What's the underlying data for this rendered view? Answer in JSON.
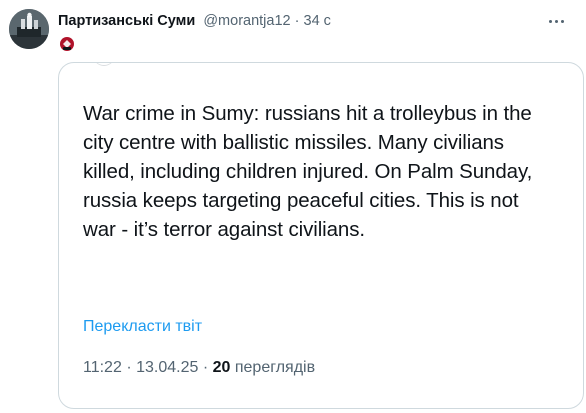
{
  "author": {
    "name": "Партизанські Суми",
    "handle": "@morantja12",
    "separator": "·",
    "time": "34 с"
  },
  "icons": {
    "avatar": "statue-avatar",
    "badge": "red-emblem-icon",
    "menu": "more-dots-icon"
  },
  "colors": {
    "link": "#1d9bf0",
    "muted": "#536471",
    "text": "#0f1419",
    "border": "#cfd9de"
  },
  "quote": {
    "text": "War crime in Sumy: russians hit a trolleybus in the city centre with ballistic missiles. Many civilians killed, including children injured. On Palm Sunday, russia keeps targeting peaceful cities. This is not war - it’s terror against civilians.",
    "translate_label": "Перекласти твіт",
    "time": "11:22",
    "separator": "·",
    "date": "13.04.25",
    "separator2": "·",
    "views_count": "20",
    "views_label": "переглядів"
  }
}
